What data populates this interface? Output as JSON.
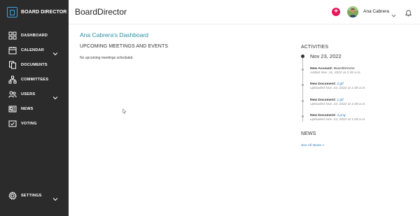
{
  "sidebar": {
    "brand": "BOARD DIRECTOR",
    "items": [
      {
        "label": "DASHBOARD",
        "icon": "dashboard-icon"
      },
      {
        "label": "CALENDAR",
        "icon": "calendar-icon"
      },
      {
        "label": "DOCUMENTS",
        "icon": "documents-icon"
      },
      {
        "label": "COMMITTEES",
        "icon": "committees-icon"
      },
      {
        "label": "USERS",
        "icon": "users-icon"
      },
      {
        "label": "NEWS",
        "icon": "news-icon"
      },
      {
        "label": "VOTING",
        "icon": "voting-icon"
      }
    ],
    "settings": {
      "label": "SETTINGS",
      "icon": "gear-icon"
    }
  },
  "header": {
    "title": "BoardDirector",
    "add_symbol": "+",
    "user_name": "Ana Cabrera"
  },
  "main": {
    "dashboard_title": "Ana Cabrera's Dashboard",
    "meetings": {
      "title": "UPCOMING MEETINGS AND EVENTS",
      "empty_text": "No upcoming meetings scheduled."
    },
    "activities": {
      "title": "ACTIVITIES",
      "date": "Nov 23, 2022",
      "items": [
        {
          "label": "New Account:",
          "target": "BoardDirector",
          "sub": "Added Nov. 16, 2022 at 2:49 a.m."
        },
        {
          "label": "New Document:",
          "target": "2.gif",
          "sub": "Uploaded Nov. 23, 2022 at 1:08 a.m."
        },
        {
          "label": "New Document:",
          "target": "1.gif",
          "sub": "Uploaded Nov. 23, 2022 at 1:08 a.m."
        },
        {
          "label": "New Document:",
          "target": "3.png",
          "sub": "Uploaded Nov. 23, 2022 at 1:08 a.m."
        }
      ]
    },
    "news": {
      "title": "NEWS",
      "see_all": "See All News >"
    }
  },
  "colors": {
    "sidebar_bg": "#2b2b2b",
    "accent": "#2a8ea0",
    "link": "#2a7dbf",
    "add_button": "#e5185b",
    "brand_logo": "#3da5e0"
  }
}
